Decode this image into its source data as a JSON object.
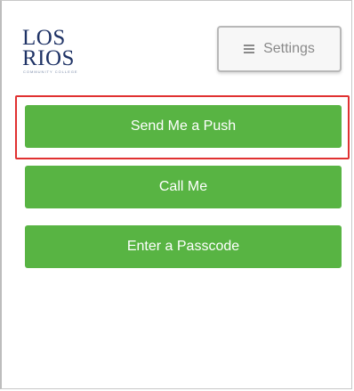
{
  "logo": {
    "line1": "LOS",
    "line2": "RIOS",
    "tagline": "COMMUNITY COLLEGE DISTRICT"
  },
  "settings": {
    "label": "Settings",
    "icon": "hamburger-menu-icon"
  },
  "actions": [
    {
      "label": "Send Me a Push",
      "highlighted": true
    },
    {
      "label": "Call Me",
      "highlighted": false
    },
    {
      "label": "Enter a Passcode",
      "highlighted": false
    }
  ],
  "colors": {
    "button_green": "#58b443",
    "highlight_red": "#e03131",
    "logo_navy": "#1f3366"
  }
}
